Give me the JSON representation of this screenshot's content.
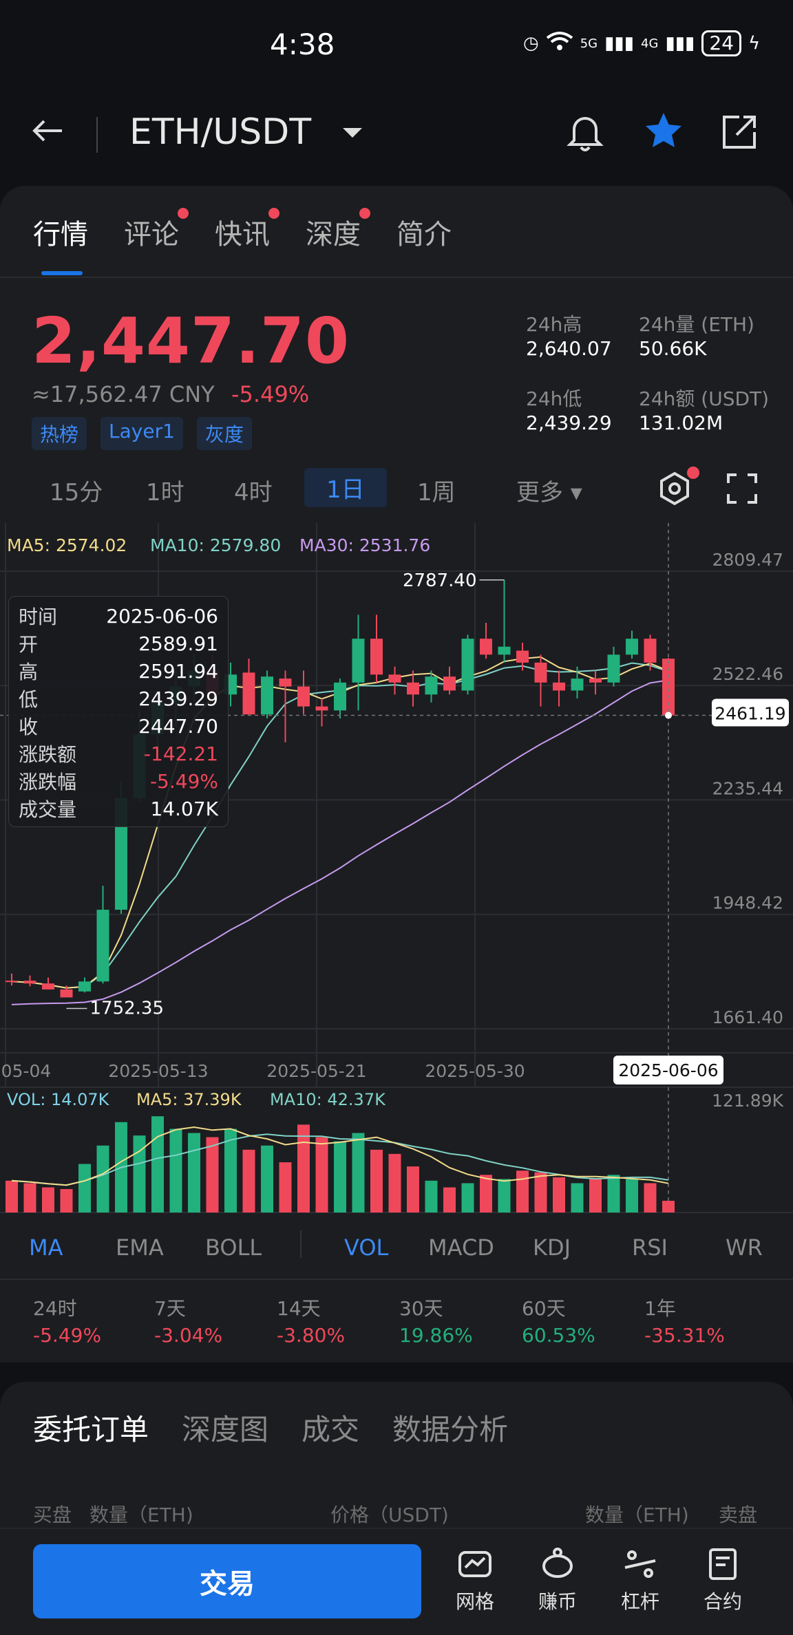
{
  "status_bar": {
    "time": "4:38",
    "battery": "24",
    "net1": "5G",
    "net2": "4G"
  },
  "header": {
    "pair": "ETH/USDT"
  },
  "tabs": [
    {
      "label": "行情"
    },
    {
      "label": "评论"
    },
    {
      "label": "快讯"
    },
    {
      "label": "深度"
    },
    {
      "label": "简介"
    }
  ],
  "ticker": {
    "price": "2,447.70",
    "cny": "≈17,562.47 CNY",
    "change": "-5.49%",
    "tags": [
      "热榜",
      "Layer1",
      "灰度"
    ],
    "stats": {
      "high_label": "24h高",
      "high": "2,640.07",
      "low_label": "24h低",
      "low": "2,439.29",
      "vol_label": "24h量 (ETH)",
      "vol": "50.66K",
      "amt_label": "24h额 (USDT)",
      "amt": "131.02M"
    }
  },
  "periods": [
    "15分",
    "1时",
    "4时",
    "1日",
    "1周",
    "更多"
  ],
  "active_period": "1日",
  "colors": {
    "up": "#22b07d",
    "down": "#f0485b",
    "accent": "#1b74e8",
    "ma5": "#f2dc8b",
    "ma10": "#7fd3c8",
    "ma30": "#c79bf0"
  },
  "ma_legend": {
    "ma5": "MA5: 2574.02",
    "ma10": "MA10: 2579.80",
    "ma30": "MA30: 2531.76"
  },
  "tooltip": [
    {
      "k": "时间",
      "v": "2025-06-06"
    },
    {
      "k": "开",
      "v": "2589.91"
    },
    {
      "k": "高",
      "v": "2591.94"
    },
    {
      "k": "低",
      "v": "2439.29"
    },
    {
      "k": "收",
      "v": "2447.70"
    },
    {
      "k": "涨跌额",
      "v": "-142.21"
    },
    {
      "k": "涨跌幅",
      "v": "-5.49%"
    },
    {
      "k": "成交量",
      "v": "14.07K"
    }
  ],
  "vol_legend": {
    "vol": "VOL: 14.07K",
    "ma5": "MA5: 37.39K",
    "ma10": "MA10: 42.37K"
  },
  "chart_data": {
    "type": "candlestick",
    "y_ticks": [
      "2809.47",
      "2522.46",
      "2235.44",
      "1948.42",
      "1661.40"
    ],
    "y_range": [
      1661.4,
      2809.47
    ],
    "x_ticks": [
      "05-04",
      "2025-05-13",
      "2025-05-21",
      "2025-05-30"
    ],
    "crosshair_date": "2025-06-06",
    "current_price_label": "2461.19",
    "max_label": "2787.40",
    "min_label": "1752.35",
    "vol_max_label": "121.89K",
    "candles": [
      {
        "o": 1782,
        "h": 1800,
        "l": 1770,
        "c": 1780
      },
      {
        "o": 1782,
        "h": 1795,
        "l": 1768,
        "c": 1775
      },
      {
        "o": 1775,
        "h": 1790,
        "l": 1765,
        "c": 1760
      },
      {
        "o": 1760,
        "h": 1770,
        "l": 1740,
        "c": 1740
      },
      {
        "o": 1755,
        "h": 1790,
        "l": 1752.35,
        "c": 1780
      },
      {
        "o": 1780,
        "h": 2020,
        "l": 1775,
        "c": 1960
      },
      {
        "o": 1960,
        "h": 2280,
        "l": 1950,
        "c": 2240
      },
      {
        "o": 2240,
        "h": 2460,
        "l": 2230,
        "c": 2400
      },
      {
        "o": 2400,
        "h": 2500,
        "l": 2340,
        "c": 2480
      },
      {
        "o": 2480,
        "h": 2560,
        "l": 2420,
        "c": 2520
      },
      {
        "o": 2520,
        "h": 2600,
        "l": 2480,
        "c": 2560
      },
      {
        "o": 2560,
        "h": 2600,
        "l": 2480,
        "c": 2500
      },
      {
        "o": 2500,
        "h": 2580,
        "l": 2470,
        "c": 2550
      },
      {
        "o": 2555,
        "h": 2590,
        "l": 2450,
        "c": 2450
      },
      {
        "o": 2450,
        "h": 2560,
        "l": 2440,
        "c": 2545
      },
      {
        "o": 2540,
        "h": 2560,
        "l": 2380,
        "c": 2520
      },
      {
        "o": 2520,
        "h": 2560,
        "l": 2450,
        "c": 2470
      },
      {
        "o": 2470,
        "h": 2490,
        "l": 2420,
        "c": 2460
      },
      {
        "o": 2460,
        "h": 2540,
        "l": 2440,
        "c": 2530
      },
      {
        "o": 2530,
        "h": 2700,
        "l": 2460,
        "c": 2640
      },
      {
        "o": 2640,
        "h": 2700,
        "l": 2530,
        "c": 2550
      },
      {
        "o": 2550,
        "h": 2570,
        "l": 2500,
        "c": 2530
      },
      {
        "o": 2530,
        "h": 2560,
        "l": 2470,
        "c": 2500
      },
      {
        "o": 2500,
        "h": 2560,
        "l": 2480,
        "c": 2545
      },
      {
        "o": 2545,
        "h": 2570,
        "l": 2500,
        "c": 2510
      },
      {
        "o": 2510,
        "h": 2650,
        "l": 2500,
        "c": 2640
      },
      {
        "o": 2640,
        "h": 2680,
        "l": 2590,
        "c": 2600
      },
      {
        "o": 2600,
        "h": 2787.4,
        "l": 2580,
        "c": 2620
      },
      {
        "o": 2610,
        "h": 2630,
        "l": 2560,
        "c": 2580
      },
      {
        "o": 2580,
        "h": 2600,
        "l": 2470,
        "c": 2530
      },
      {
        "o": 2530,
        "h": 2560,
        "l": 2470,
        "c": 2510
      },
      {
        "o": 2510,
        "h": 2570,
        "l": 2490,
        "c": 2540
      },
      {
        "o": 2540,
        "h": 2560,
        "l": 2500,
        "c": 2530
      },
      {
        "o": 2530,
        "h": 2620,
        "l": 2520,
        "c": 2600
      },
      {
        "o": 2600,
        "h": 2660,
        "l": 2590,
        "c": 2640
      },
      {
        "o": 2640,
        "h": 2650,
        "l": 2560,
        "c": 2580
      },
      {
        "o": 2589.91,
        "h": 2591.94,
        "l": 2439.29,
        "c": 2447.7
      }
    ],
    "volumes": [
      38,
      35,
      30,
      28,
      58,
      80,
      108,
      92,
      115,
      100,
      95,
      90,
      100,
      75,
      80,
      60,
      105,
      90,
      85,
      95,
      75,
      70,
      55,
      38,
      30,
      35,
      45,
      40,
      50,
      48,
      42,
      35,
      40,
      45,
      40,
      35,
      14
    ]
  },
  "indicators": [
    "MA",
    "EMA",
    "BOLL",
    "VOL",
    "MACD",
    "KDJ",
    "RSI",
    "WR"
  ],
  "performance": [
    {
      "label": "24时",
      "value": "-5.49%",
      "dir": "down"
    },
    {
      "label": "7天",
      "value": "-3.04%",
      "dir": "down"
    },
    {
      "label": "14天",
      "value": "-3.80%",
      "dir": "down"
    },
    {
      "label": "30天",
      "value": "19.86%",
      "dir": "up"
    },
    {
      "label": "60天",
      "value": "60.53%",
      "dir": "up"
    },
    {
      "label": "1年",
      "value": "-35.31%",
      "dir": "down"
    }
  ],
  "order_tabs": [
    "委托订单",
    "深度图",
    "成交",
    "数据分析"
  ],
  "order_header": {
    "bid": "买盘",
    "qty": "数量（ETH)",
    "price": "价格（USDT)",
    "qty2": "数量（ETH)",
    "ask": "卖盘"
  },
  "bottom": {
    "trade": "交易",
    "nav": [
      "网格",
      "赚币",
      "杠杆",
      "合约"
    ]
  }
}
